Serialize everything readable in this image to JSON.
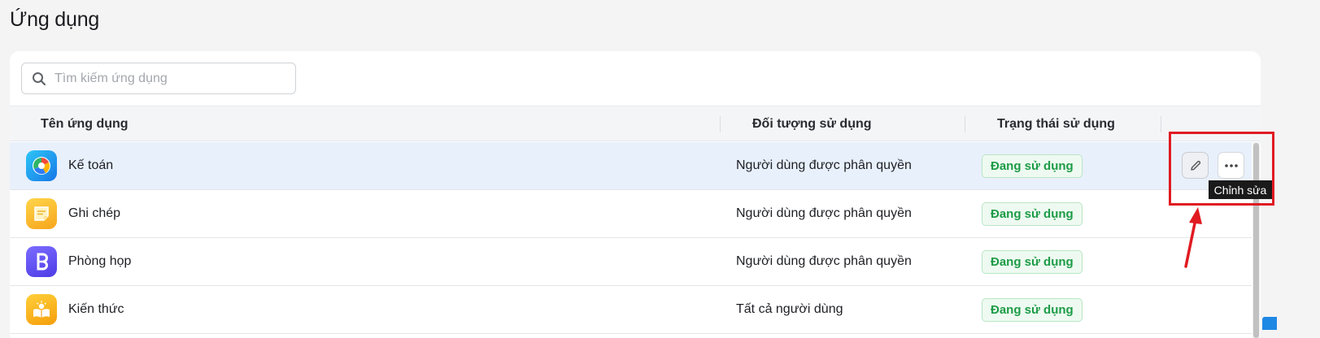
{
  "page": {
    "title": "Ứng dụng"
  },
  "search": {
    "placeholder": "Tìm kiếm ứng dụng",
    "value": ""
  },
  "table": {
    "columns": [
      "Tên ứng dụng",
      "Đối tượng sử dụng",
      "Trạng thái sử dụng"
    ],
    "rows": [
      {
        "name": "Kế toán",
        "target": "Người dùng được phân quyền",
        "status": "Đang sử dụng",
        "icon": "accounting-icon"
      },
      {
        "name": "Ghi chép",
        "target": "Người dùng được phân quyền",
        "status": "Đang sử dụng",
        "icon": "notes-icon"
      },
      {
        "name": "Phòng họp",
        "target": "Người dùng được phân quyền",
        "status": "Đang sử dụng",
        "icon": "meeting-room-icon"
      },
      {
        "name": "Kiến thức",
        "target": "Tất cả người dùng",
        "status": "Đang sử dụng",
        "icon": "knowledge-icon"
      }
    ]
  },
  "actions": {
    "edit_tooltip": "Chỉnh sửa"
  },
  "colors": {
    "status_green": "#1d9b46",
    "highlight_red": "#e01b22",
    "active_row": "#e8f0fb"
  }
}
